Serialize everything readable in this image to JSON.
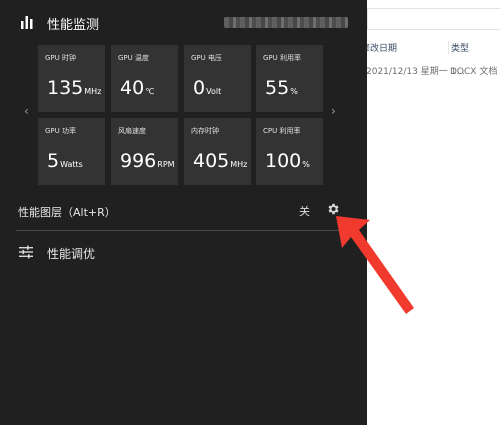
{
  "explorer": {
    "columns": {
      "date": "修改日期",
      "type": "类型"
    },
    "row": {
      "date": "2021/12/13 星期一 1...",
      "type": "DOCX 文档"
    }
  },
  "panel": {
    "title": "性能监测",
    "header_icon": "bar-chart-icon",
    "blurred_info_icon": "redacted-device-info",
    "nav": {
      "prev": "‹",
      "next": "›"
    },
    "tiles": [
      {
        "label": "GPU 时钟",
        "value": "135",
        "unit": "MHz"
      },
      {
        "label": "GPU 温度",
        "value": "40",
        "unit": "℃"
      },
      {
        "label": "GPU 电压",
        "value": "0",
        "unit": "Volt"
      },
      {
        "label": "GPU 利用率",
        "value": "55",
        "unit": "%"
      },
      {
        "label": "GPU 功率",
        "value": "5",
        "unit": "Watts"
      },
      {
        "label": "风扇速度",
        "value": "996",
        "unit": "RPM"
      },
      {
        "label": "内存时钟",
        "value": "405",
        "unit": "MHz"
      },
      {
        "label": "CPU 利用率",
        "value": "100",
        "unit": "%"
      }
    ],
    "overlay": {
      "label": "性能图层（Alt+R）",
      "state": "关",
      "settings_icon": "gear-icon"
    },
    "tuning": {
      "label": "性能调优",
      "icon": "sliders-icon"
    }
  },
  "colors": {
    "panel_bg": "#202020",
    "tile_bg": "#333333",
    "annotation": "#f03a2e"
  }
}
